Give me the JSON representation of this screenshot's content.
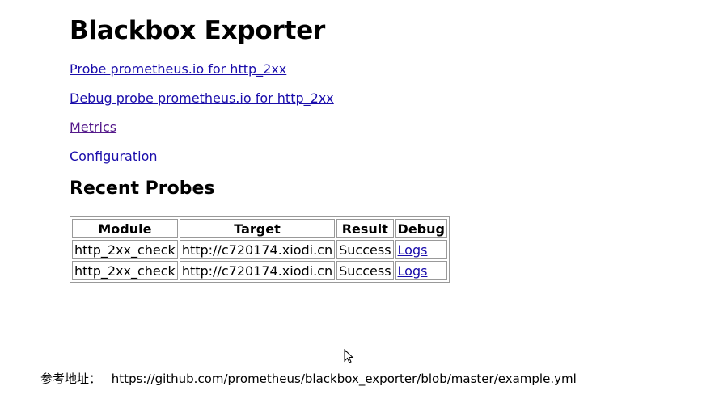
{
  "page": {
    "title": "Blackbox Exporter"
  },
  "links": {
    "probe": "Probe prometheus.io for http_2xx",
    "debug_probe": "Debug probe prometheus.io for http_2xx",
    "metrics": "Metrics",
    "configuration": "Configuration"
  },
  "recent_probes": {
    "heading": "Recent Probes",
    "columns": [
      "Module",
      "Target",
      "Result",
      "Debug"
    ],
    "rows": [
      {
        "module": "http_2xx_check",
        "target": "http://c720174.xiodi.cn",
        "result": "Success",
        "debug": "Logs"
      },
      {
        "module": "http_2xx_check",
        "target": "http://c720174.xiodi.cn",
        "result": "Success",
        "debug": "Logs"
      }
    ]
  },
  "reference": {
    "label": "参考地址：",
    "url": "https://github.com/prometheus/blackbox_exporter/blob/master/example.yml"
  },
  "colors": {
    "link": "#1a0dab",
    "visited_link": "#551a8b"
  }
}
